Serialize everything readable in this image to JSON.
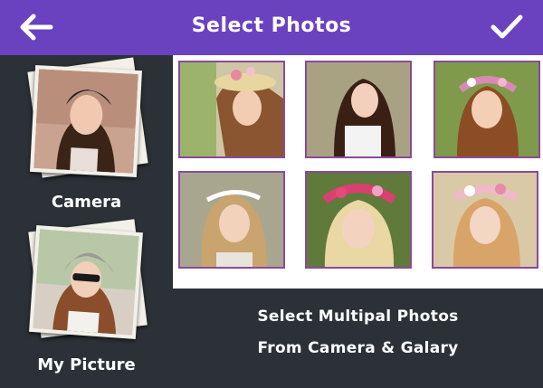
{
  "header": {
    "title": "Select Photos",
    "back_icon": "arrow-left-icon",
    "confirm_icon": "checkmark-icon",
    "bar_color": "#6a42c0"
  },
  "sidebar": {
    "camera_label": "Camera",
    "gallery_label": "My Picture"
  },
  "grid": {
    "border_color": "#8a4a9a",
    "photos": [
      {
        "name": "photo-1",
        "label": ""
      },
      {
        "name": "photo-2",
        "label": ""
      },
      {
        "name": "photo-3",
        "label": ""
      },
      {
        "name": "photo-4",
        "label": ""
      },
      {
        "name": "photo-5",
        "label": ""
      },
      {
        "name": "photo-6",
        "label": ""
      }
    ]
  },
  "info": {
    "line1": "Select Multipal Photos",
    "line2": "From Camera & Galary"
  }
}
